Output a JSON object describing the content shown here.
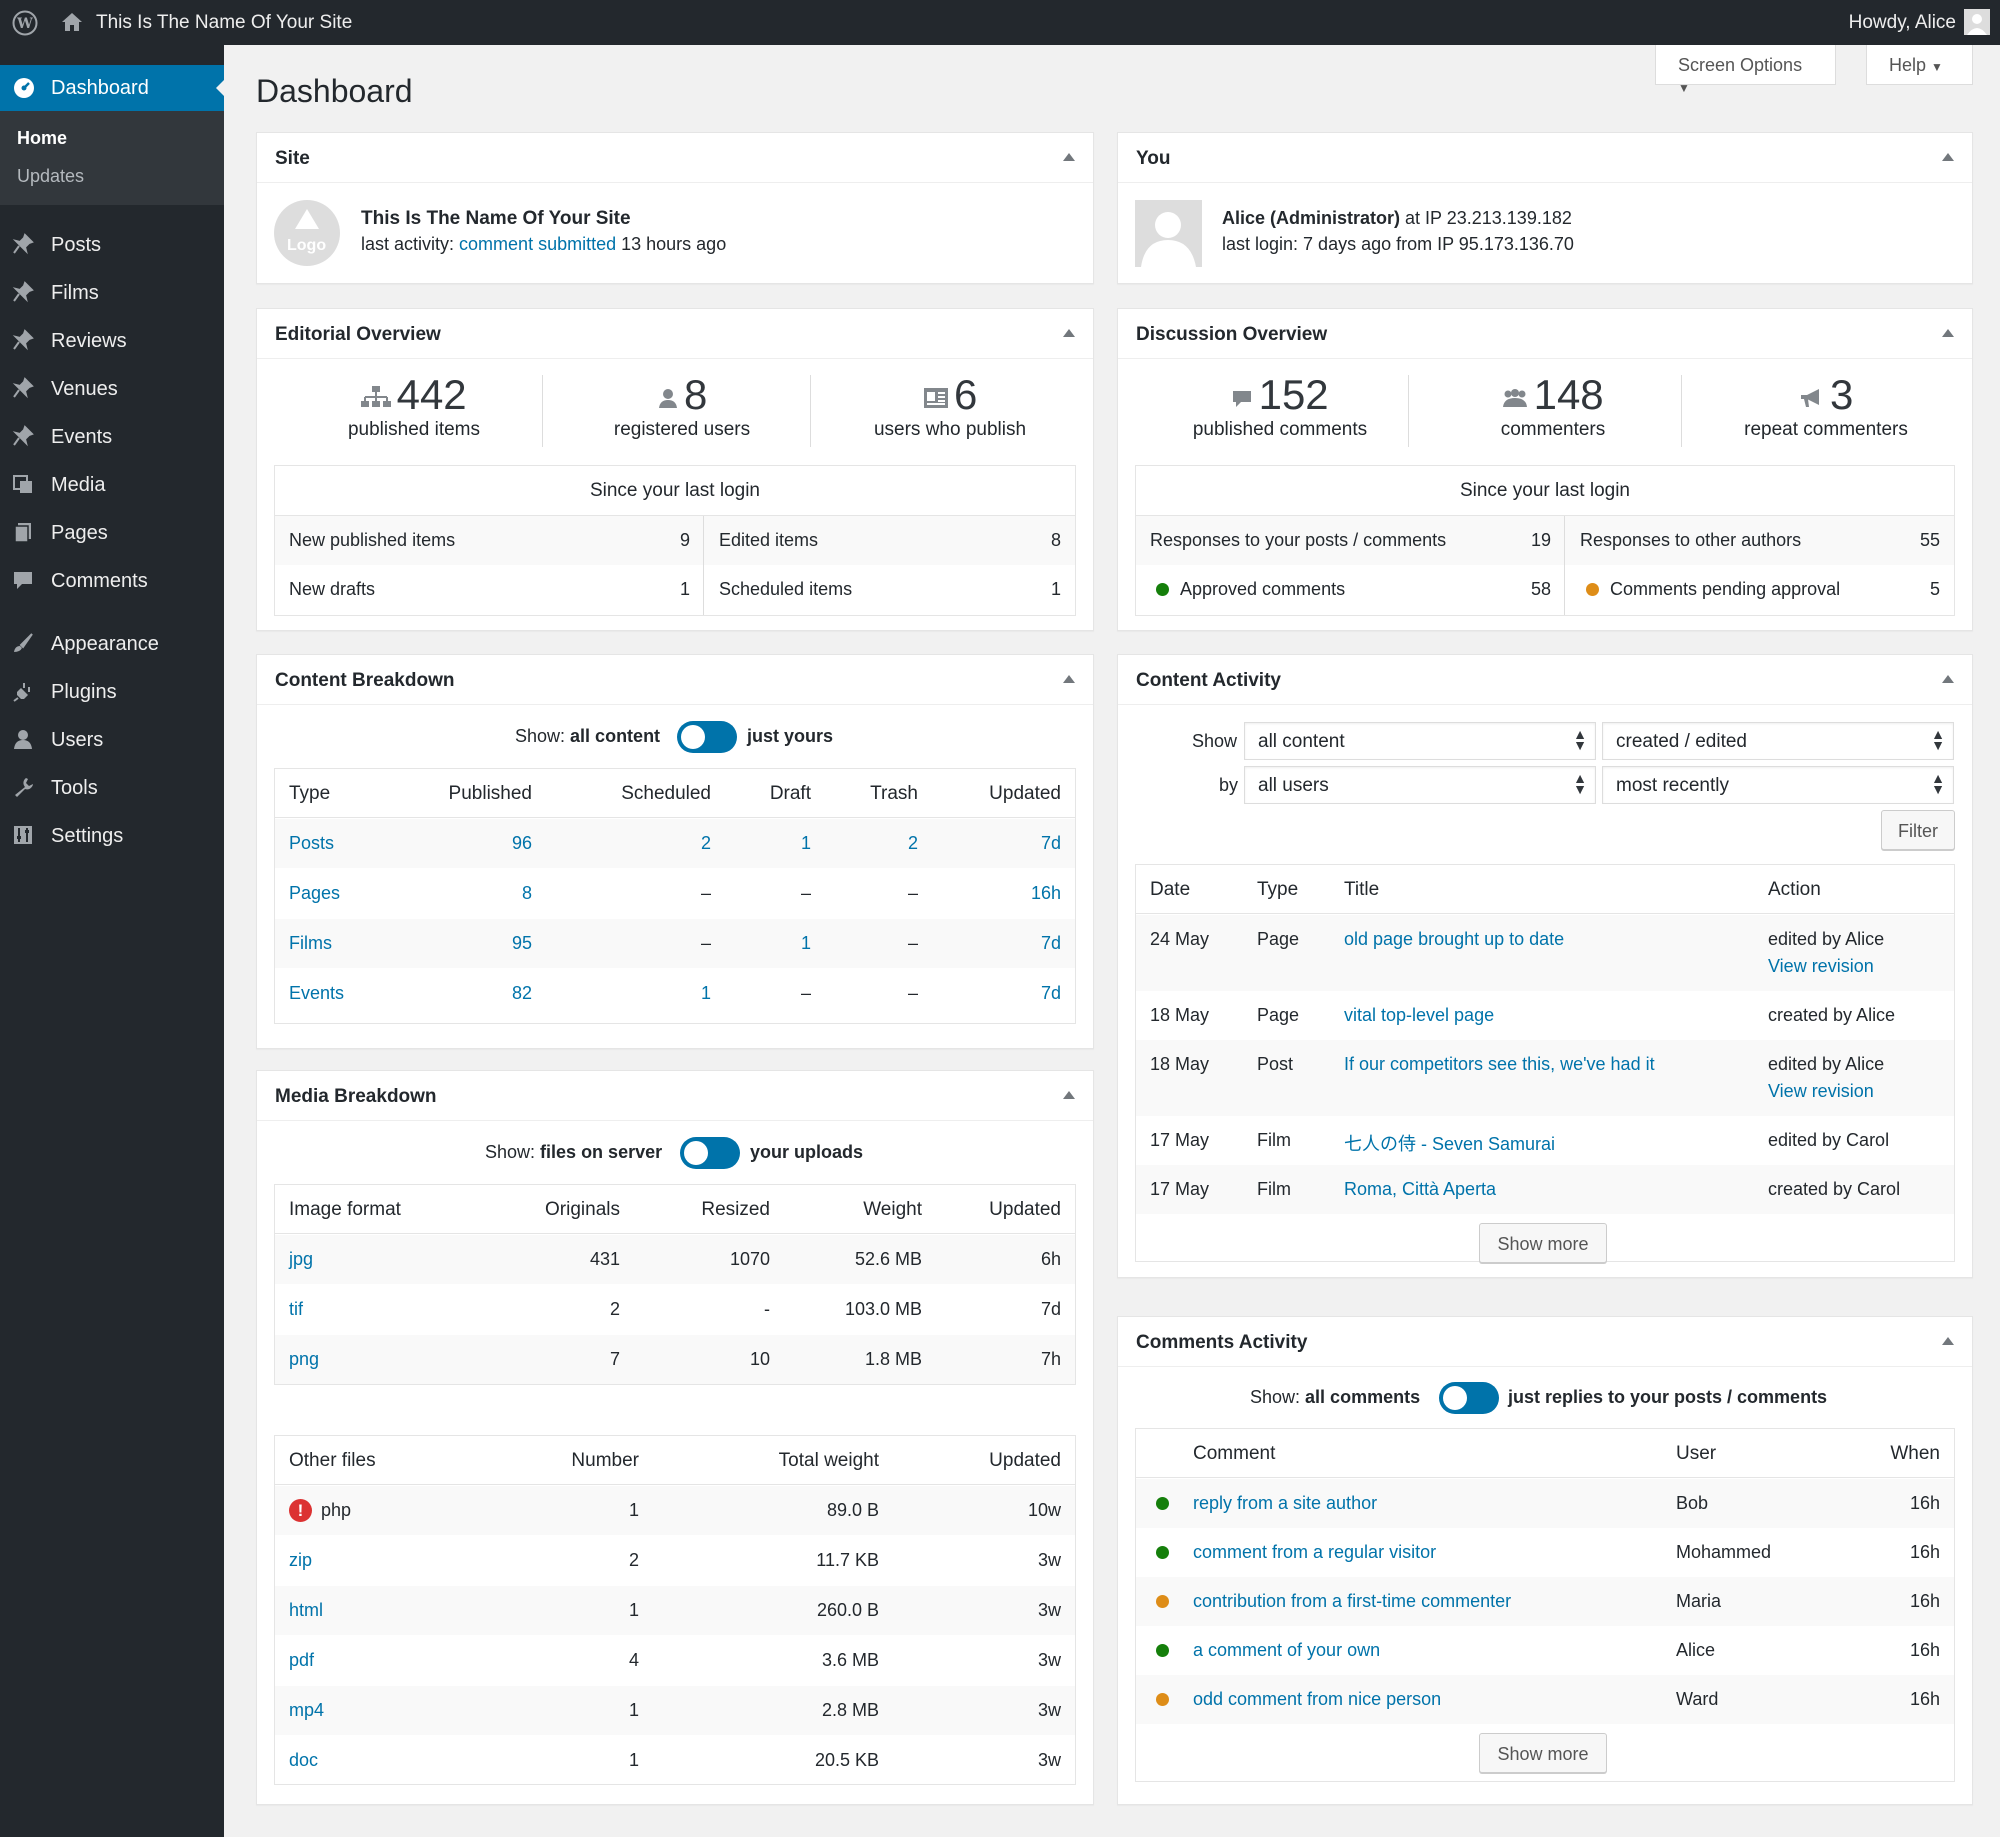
{
  "admin_bar": {
    "site_name": "This Is The Name Of Your Site",
    "howdy": "Howdy, Alice"
  },
  "sidebar": {
    "current": "Dashboard",
    "submenu": [
      "Home",
      "Updates"
    ],
    "items": [
      "Posts",
      "Films",
      "Reviews",
      "Venues",
      "Events",
      "Media",
      "Pages",
      "Comments",
      "Appearance",
      "Plugins",
      "Users",
      "Tools",
      "Settings"
    ]
  },
  "header": {
    "title": "Dashboard",
    "screen_options": "Screen Options",
    "help": "Help"
  },
  "site_box": {
    "title": "Site",
    "logo": "Logo",
    "name": "This Is The Name Of Your Site",
    "activity_prefix": "last activity:",
    "activity_link": "comment submitted",
    "activity_suffix": "13 hours ago"
  },
  "you_box": {
    "title": "You",
    "user": "Alice (Administrator)",
    "ip_text": "at IP 23.213.139.182",
    "last_login": "last login: 7 days ago from IP 95.173.136.70"
  },
  "editorial": {
    "title": "Editorial Overview",
    "stats": [
      {
        "num": "442",
        "label": "published items"
      },
      {
        "num": "8",
        "label": "registered users"
      },
      {
        "num": "6",
        "label": "users who publish"
      }
    ],
    "since": "Since your last login",
    "rows": [
      {
        "l1": "New published items",
        "v1": "9",
        "l2": "Edited items",
        "v2": "8"
      },
      {
        "l1": "New drafts",
        "v1": "1",
        "l2": "Scheduled items",
        "v2": "1"
      }
    ]
  },
  "discussion": {
    "title": "Discussion Overview",
    "stats": [
      {
        "num": "152",
        "label": "published comments"
      },
      {
        "num": "148",
        "label": "commenters"
      },
      {
        "num": "3",
        "label": "repeat commenters"
      }
    ],
    "since": "Since your last login",
    "rows": [
      {
        "l1": "Responses to your posts / comments",
        "v1": "19",
        "l2": "Responses to other authors",
        "v2": "55"
      },
      {
        "l1": "Approved comments",
        "v1": "58",
        "l2": "Comments pending approval",
        "v2": "5"
      }
    ]
  },
  "content_breakdown": {
    "title": "Content Breakdown",
    "show_label": "Show:",
    "show_left": "all content",
    "show_right": "just yours",
    "headers": [
      "Type",
      "Published",
      "Scheduled",
      "Draft",
      "Trash",
      "Updated"
    ],
    "rows": [
      [
        "Posts",
        "96",
        "2",
        "1",
        "2",
        "7d"
      ],
      [
        "Pages",
        "8",
        "–",
        "–",
        "–",
        "16h"
      ],
      [
        "Films",
        "95",
        "–",
        "1",
        "–",
        "7d"
      ],
      [
        "Events",
        "82",
        "1",
        "–",
        "–",
        "7d"
      ]
    ]
  },
  "media_breakdown": {
    "title": "Media Breakdown",
    "show_label": "Show:",
    "show_left": "files on server",
    "show_right": "your uploads",
    "img_headers": [
      "Image format",
      "Originals",
      "Resized",
      "Weight",
      "Updated"
    ],
    "img_rows": [
      [
        "jpg",
        "431",
        "1070",
        "52.6 MB",
        "6h"
      ],
      [
        "tif",
        "2",
        "-",
        "103.0 MB",
        "7d"
      ],
      [
        "png",
        "7",
        "10",
        "1.8 MB",
        "7h"
      ]
    ],
    "other_headers": [
      "Other files",
      "Number",
      "Total weight",
      "Updated"
    ],
    "other_rows": [
      [
        "php",
        "1",
        "89.0 B",
        "10w"
      ],
      [
        "zip",
        "2",
        "11.7 KB",
        "3w"
      ],
      [
        "html",
        "1",
        "260.0 B",
        "3w"
      ],
      [
        "pdf",
        "4",
        "3.6 MB",
        "3w"
      ],
      [
        "mp4",
        "1",
        "2.8 MB",
        "3w"
      ],
      [
        "doc",
        "1",
        "20.5 KB",
        "3w"
      ]
    ]
  },
  "content_activity": {
    "title": "Content Activity",
    "show_label": "Show",
    "by_label": "by",
    "sel_content": "all content",
    "sel_action": "created / edited",
    "sel_users": "all users",
    "sel_order": "most recently",
    "filter": "Filter",
    "headers": [
      "Date",
      "Type",
      "Title",
      "Action"
    ],
    "rows": [
      {
        "date": "24 May",
        "type": "Page",
        "title": "old page brought up to date",
        "action": "edited by Alice",
        "rev": "View revision"
      },
      {
        "date": "18 May",
        "type": "Page",
        "title": "vital top-level page",
        "action": "created by Alice",
        "rev": ""
      },
      {
        "date": "18 May",
        "type": "Post",
        "title": "If our competitors see this, we've had it",
        "action": "edited by Alice",
        "rev": "View revision"
      },
      {
        "date": "17 May",
        "type": "Film",
        "title": "七人の侍 - Seven Samurai",
        "action": "edited by Carol",
        "rev": ""
      },
      {
        "date": "17 May",
        "type": "Film",
        "title": "Roma, Città Aperta",
        "action": "created by Carol",
        "rev": ""
      }
    ],
    "show_more": "Show more"
  },
  "comments_activity": {
    "title": "Comments Activity",
    "show_label": "Show:",
    "show_left": "all comments",
    "show_right": "just replies to your posts / comments",
    "headers": [
      "Comment",
      "User",
      "When"
    ],
    "rows": [
      {
        "status": "approved",
        "comment": "reply from a site author",
        "user": "Bob",
        "when": "16h"
      },
      {
        "status": "approved",
        "comment": "comment from a regular visitor",
        "user": "Mohammed",
        "when": "16h"
      },
      {
        "status": "pending",
        "comment": "contribution from a first-time commenter",
        "user": "Maria",
        "when": "16h"
      },
      {
        "status": "approved",
        "comment": "a comment of your own",
        "user": "Alice",
        "when": "16h"
      },
      {
        "status": "pending",
        "comment": "odd comment from nice person",
        "user": "Ward",
        "when": "16h"
      }
    ],
    "show_more": "Show more"
  },
  "colors": {
    "accent": "#0073aa",
    "sidebar": "#23282d",
    "approved": "#157f0b",
    "pending": "#de8d18",
    "error": "#dc3232"
  }
}
